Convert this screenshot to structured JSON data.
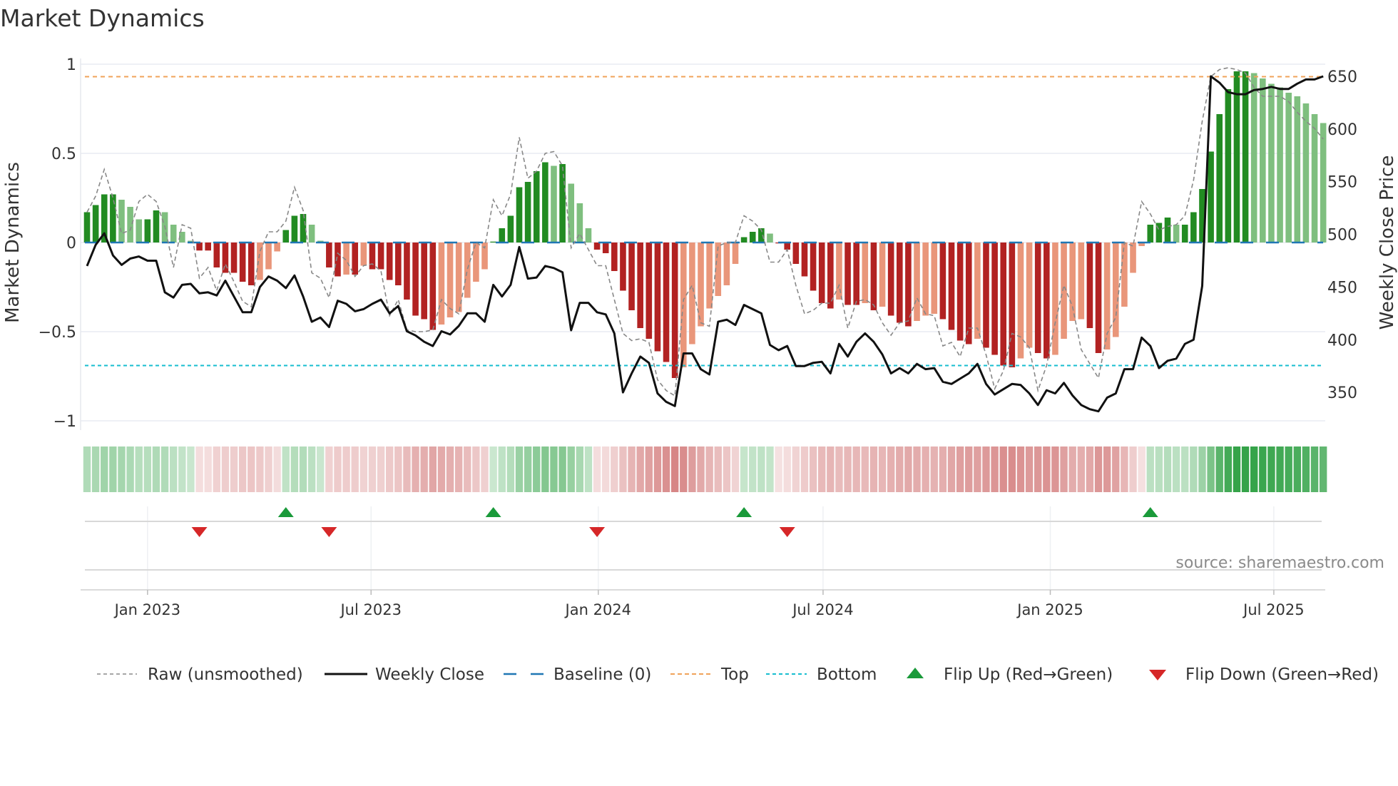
{
  "chart_data": {
    "type": "bar",
    "title": "Market Dynamics",
    "ylabel": "Market Dynamics",
    "y2label": "Weekly Close Price",
    "ylim": [
      -1.05,
      1.04
    ],
    "y2lim": [
      314,
      667
    ],
    "yticks": [
      {
        "v": 1,
        "label": "1"
      },
      {
        "v": 0.5,
        "label": "0.5"
      },
      {
        "v": 0,
        "label": "0"
      },
      {
        "v": -0.5,
        "label": "−0.5"
      },
      {
        "v": -1,
        "label": "−1"
      }
    ],
    "y2ticks": [
      {
        "v": 650,
        "label": "650"
      },
      {
        "v": 600,
        "label": "600"
      },
      {
        "v": 550,
        "label": "550"
      },
      {
        "v": 500,
        "label": "500"
      },
      {
        "v": 450,
        "label": "450"
      },
      {
        "v": 400,
        "label": "400"
      },
      {
        "v": 350,
        "label": "350"
      }
    ],
    "xticks": [
      {
        "date": "2023-01-01",
        "label": "Jan 2023"
      },
      {
        "date": "2023-07-01",
        "label": "Jul 2023"
      },
      {
        "date": "2024-01-01",
        "label": "Jan 2024"
      },
      {
        "date": "2024-07-01",
        "label": "Jul 2024"
      },
      {
        "date": "2025-01-01",
        "label": "Jan 2025"
      },
      {
        "date": "2025-07-01",
        "label": "Jul 2025"
      }
    ],
    "start_date": "2022-11-13",
    "frequency": "weekly",
    "top_level": 0.93,
    "bottom_level": -0.69,
    "baseline": 0,
    "momentum": [
      0.17,
      0.21,
      0.27,
      0.27,
      0.24,
      0.2,
      0.13,
      0.13,
      0.18,
      0.17,
      0.1,
      0.06,
      0.01,
      -0.045,
      -0.045,
      -0.14,
      -0.17,
      -0.17,
      -0.22,
      -0.24,
      -0.21,
      -0.15,
      -0.05,
      0.07,
      0.15,
      0.16,
      0.1,
      0.01,
      -0.14,
      -0.19,
      -0.18,
      -0.18,
      -0.13,
      -0.15,
      -0.15,
      -0.21,
      -0.24,
      -0.32,
      -0.41,
      -0.43,
      -0.49,
      -0.46,
      -0.42,
      -0.39,
      -0.31,
      -0.22,
      -0.15,
      0.005,
      0.08,
      0.15,
      0.31,
      0.34,
      0.4,
      0.45,
      0.43,
      0.44,
      0.33,
      0.22,
      0.08,
      -0.04,
      -0.06,
      -0.16,
      -0.27,
      -0.38,
      -0.48,
      -0.54,
      -0.61,
      -0.67,
      -0.76,
      -0.7,
      -0.57,
      -0.47,
      -0.37,
      -0.3,
      -0.24,
      -0.12,
      0.03,
      0.06,
      0.08,
      0.05,
      -0.005,
      -0.04,
      -0.12,
      -0.19,
      -0.27,
      -0.34,
      -0.37,
      -0.32,
      -0.35,
      -0.35,
      -0.34,
      -0.38,
      -0.36,
      -0.41,
      -0.45,
      -0.47,
      -0.44,
      -0.41,
      -0.4,
      -0.43,
      -0.49,
      -0.55,
      -0.57,
      -0.54,
      -0.59,
      -0.63,
      -0.69,
      -0.7,
      -0.65,
      -0.59,
      -0.62,
      -0.65,
      -0.63,
      -0.54,
      -0.44,
      -0.43,
      -0.48,
      -0.62,
      -0.6,
      -0.53,
      -0.36,
      -0.17,
      -0.02,
      0.1,
      0.11,
      0.14,
      0.1,
      0.1,
      0.17,
      0.3,
      0.51,
      0.72,
      0.86,
      0.96,
      0.96,
      0.95,
      0.92,
      0.89,
      0.87,
      0.84,
      0.82,
      0.78,
      0.72,
      0.67
    ],
    "raw": [
      0.17,
      0.26,
      0.41,
      0.25,
      0.05,
      0.07,
      0.23,
      0.27,
      0.23,
      0.09,
      -0.14,
      0.1,
      0.08,
      -0.2,
      -0.14,
      -0.27,
      -0.12,
      -0.22,
      -0.33,
      -0.36,
      -0.05,
      0.06,
      0.06,
      0.12,
      0.31,
      0.18,
      -0.17,
      -0.2,
      -0.31,
      -0.06,
      -0.1,
      -0.19,
      -0.13,
      -0.12,
      -0.16,
      -0.41,
      -0.32,
      -0.49,
      -0.5,
      -0.5,
      -0.49,
      -0.32,
      -0.37,
      -0.4,
      -0.15,
      0.0,
      -0.03,
      0.24,
      0.15,
      0.27,
      0.59,
      0.36,
      0.4,
      0.5,
      0.51,
      0.43,
      -0.03,
      0.05,
      -0.04,
      -0.13,
      -0.13,
      -0.32,
      -0.51,
      -0.55,
      -0.54,
      -0.56,
      -0.77,
      -0.83,
      -0.86,
      -0.32,
      -0.24,
      -0.45,
      -0.47,
      -0.02,
      0.0,
      0.0,
      0.15,
      0.12,
      0.07,
      -0.11,
      -0.11,
      -0.04,
      -0.24,
      -0.4,
      -0.38,
      -0.34,
      -0.34,
      -0.24,
      -0.48,
      -0.33,
      -0.32,
      -0.35,
      -0.45,
      -0.52,
      -0.45,
      -0.44,
      -0.31,
      -0.4,
      -0.41,
      -0.58,
      -0.56,
      -0.64,
      -0.48,
      -0.48,
      -0.63,
      -0.82,
      -0.72,
      -0.51,
      -0.53,
      -0.59,
      -0.83,
      -0.69,
      -0.45,
      -0.24,
      -0.36,
      -0.6,
      -0.68,
      -0.76,
      -0.51,
      -0.42,
      0.0,
      -0.02,
      0.23,
      0.16,
      0.07,
      0.09,
      0.1,
      0.15,
      0.35,
      0.68,
      0.93,
      0.97,
      0.98,
      0.97,
      0.95,
      0.87,
      0.82,
      0.82,
      0.82,
      0.79,
      0.73,
      0.68,
      0.64,
      0.58
    ],
    "close": [
      470,
      490,
      501,
      480,
      471,
      477,
      479,
      475,
      475,
      445,
      440,
      452,
      453,
      444,
      445,
      442,
      456,
      441,
      426,
      426,
      450,
      460,
      456,
      449,
      461,
      441,
      417,
      421,
      412,
      437,
      434,
      427,
      429,
      434,
      438,
      425,
      432,
      408,
      404,
      398,
      394,
      408,
      405,
      413,
      425,
      425,
      417,
      452,
      441,
      452,
      488,
      458,
      459,
      470,
      468,
      464,
      409,
      435,
      435,
      426,
      424,
      406,
      350,
      368,
      384,
      378,
      349,
      341,
      337,
      387,
      387,
      372,
      367,
      417,
      419,
      414,
      433,
      429,
      425,
      395,
      390,
      394,
      375,
      375,
      378,
      379,
      368,
      396,
      384,
      398,
      406,
      398,
      386,
      368,
      373,
      368,
      377,
      372,
      373,
      360,
      358,
      363,
      368,
      377,
      358,
      348,
      353,
      358,
      357,
      349,
      338,
      352,
      349,
      359,
      347,
      338,
      334,
      332,
      345,
      349,
      372,
      372,
      402,
      394,
      373,
      380,
      382,
      396,
      400,
      451,
      650,
      644,
      635,
      633,
      633,
      637,
      638,
      640,
      638,
      638,
      643,
      647,
      647,
      650
    ],
    "flip_up_weeks": [
      24,
      48,
      77,
      124
    ],
    "flip_down_weeks": [
      14,
      29,
      60,
      82
    ],
    "legend": {
      "placement": "bottom",
      "items": [
        {
          "key": "raw",
          "label": "Raw (unsmoothed)"
        },
        {
          "key": "close",
          "label": "Weekly Close"
        },
        {
          "key": "baseline",
          "label": "Baseline (0)"
        },
        {
          "key": "top",
          "label": "Top"
        },
        {
          "key": "bottom",
          "label": "Bottom"
        },
        {
          "key": "flip_up",
          "label": "Flip Up (Red→Green)"
        },
        {
          "key": "flip_down",
          "label": "Flip Down (Green→Red)"
        }
      ]
    },
    "source": "source: sharemaestro.com"
  },
  "colors": {
    "green_strong": "#228b22",
    "green_fading": "#7fbf7f",
    "red_strong": "#b22222",
    "red_fading": "#e9967a",
    "baseline": "#1f77b4",
    "top": "#f0a35a",
    "bottom": "#17becf",
    "raw": "#888888",
    "close": "#111111",
    "flip_up": "#1a9a3a",
    "flip_down": "#d62728"
  }
}
